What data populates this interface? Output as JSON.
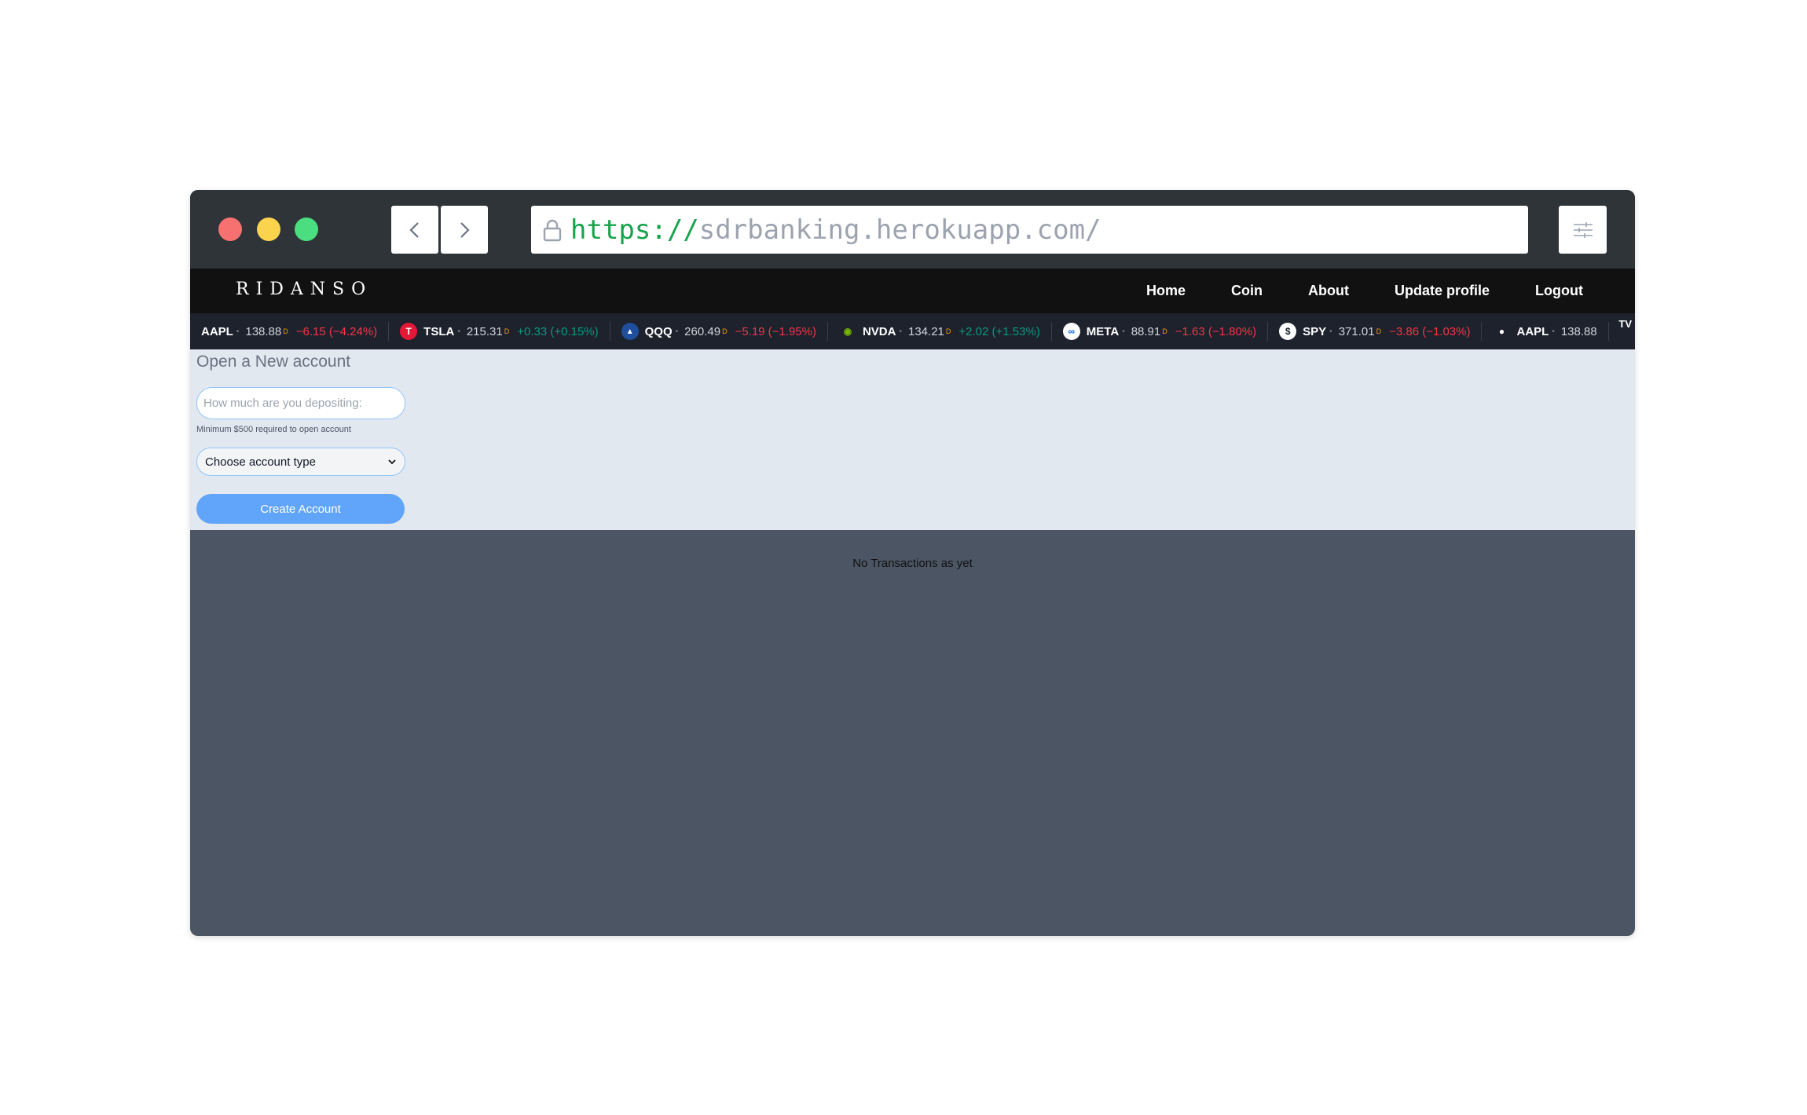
{
  "browser": {
    "url_scheme": "https://",
    "url_host": "sdrbanking.herokuapp.com/"
  },
  "site": {
    "brand": "RIDANSO",
    "nav": [
      {
        "label": "Home"
      },
      {
        "label": "Coin"
      },
      {
        "label": "About"
      },
      {
        "label": "Update profile"
      },
      {
        "label": "Logout"
      }
    ]
  },
  "ticker": [
    {
      "symbol": "AAPL",
      "price": "138.88",
      "change": "−6.15 (−4.24%)",
      "direction": "neg",
      "logo_color": "#1e222d",
      "logo_glyph": ""
    },
    {
      "symbol": "TSLA",
      "price": "215.31",
      "change": "+0.33 (+0.15%)",
      "direction": "pos",
      "logo_color": "#e31937",
      "logo_glyph": "T"
    },
    {
      "symbol": "QQQ",
      "price": "260.49",
      "change": "−5.19 (−1.95%)",
      "direction": "neg",
      "logo_color": "#1f4e9c",
      "logo_glyph": "▲"
    },
    {
      "symbol": "NVDA",
      "price": "134.21",
      "change": "+2.02 (+1.53%)",
      "direction": "pos",
      "logo_color": "#1e222d",
      "logo_glyph": "◉"
    },
    {
      "symbol": "META",
      "price": "88.91",
      "change": "−1.63 (−1.80%)",
      "direction": "neg",
      "logo_color": "#ffffff",
      "logo_glyph": "∞"
    },
    {
      "symbol": "SPY",
      "price": "371.01",
      "change": "−3.86 (−1.03%)",
      "direction": "neg",
      "logo_color": "#ffffff",
      "logo_glyph": "$"
    },
    {
      "symbol": "AAPL",
      "price": "138.88",
      "change": "",
      "direction": "neg",
      "logo_color": "#1e222d",
      "logo_glyph": ""
    }
  ],
  "ticker_delayed_mark": "D",
  "ticker_brand": "TV",
  "account_form": {
    "title": "Open a New account",
    "deposit_placeholder": "How much are you depositing:",
    "hint": "Minimum $500 required to open account",
    "account_type_selected": "Choose account type",
    "create_label": "Create Account"
  },
  "transactions": {
    "empty_message": "No Transactions as yet"
  },
  "colors": {
    "accent": "#60a5fa",
    "negative": "#f23645",
    "positive": "#089981"
  }
}
